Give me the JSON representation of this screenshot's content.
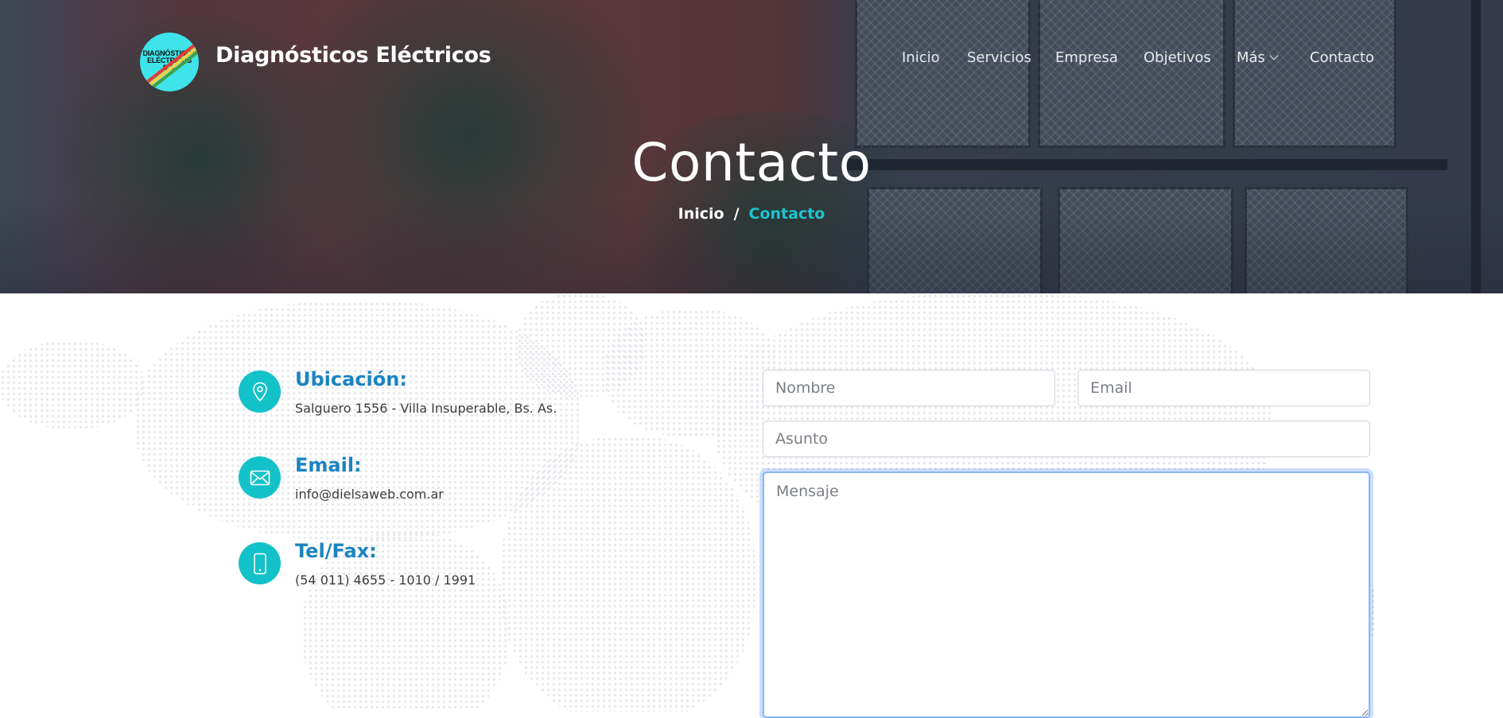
{
  "header": {
    "logo_text": "DIAGNÓSTICOS ELÉCTRICOS S.A.",
    "brand_name": "Diagnósticos Eléctricos",
    "nav": [
      {
        "label": "Inicio"
      },
      {
        "label": "Servicios"
      },
      {
        "label": "Empresa"
      },
      {
        "label": "Objetivos"
      },
      {
        "label": "Más",
        "has_dropdown": true
      },
      {
        "label": "Contacto"
      }
    ]
  },
  "hero": {
    "title": "Contacto",
    "breadcrumb": {
      "home": "Inicio",
      "separator": "/",
      "current": "Contacto"
    }
  },
  "contact_info": [
    {
      "icon": "map-pin-icon",
      "title": "Ubicación:",
      "text": "Salguero 1556 - Villa Insuperable, Bs. As."
    },
    {
      "icon": "envelope-icon",
      "title": "Email:",
      "text": "info@dielsaweb.com.ar"
    },
    {
      "icon": "mobile-phone-icon",
      "title": "Tel/Fax:",
      "text": "(54 011) 4655 - 1010 / 1991"
    }
  ],
  "form": {
    "name_placeholder": "Nombre",
    "email_placeholder": "Email",
    "subject_placeholder": "Asunto",
    "message_placeholder": "Mensaje"
  },
  "colors": {
    "accent": "#13c2c8",
    "heading_blue": "#1a84c1",
    "breadcrumb_current": "#1cc4cf",
    "logo_bg": "#3fe3ea"
  }
}
